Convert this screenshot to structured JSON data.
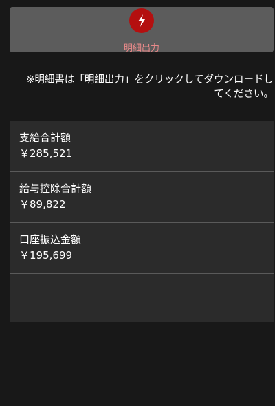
{
  "export_button": {
    "label": "明細出力",
    "icon": "lightning-icon",
    "icon_color": "#b40f0f"
  },
  "notice": {
    "line1": "※明細書は「明細出力」をクリックしてダウンロードし",
    "line2": "てください。"
  },
  "summary": {
    "rows": [
      {
        "label": "支給合計額",
        "value": "￥285,521"
      },
      {
        "label": "給与控除合計額",
        "value": "￥89,822"
      },
      {
        "label": "口座振込金額",
        "value": "￥195,699"
      }
    ]
  }
}
